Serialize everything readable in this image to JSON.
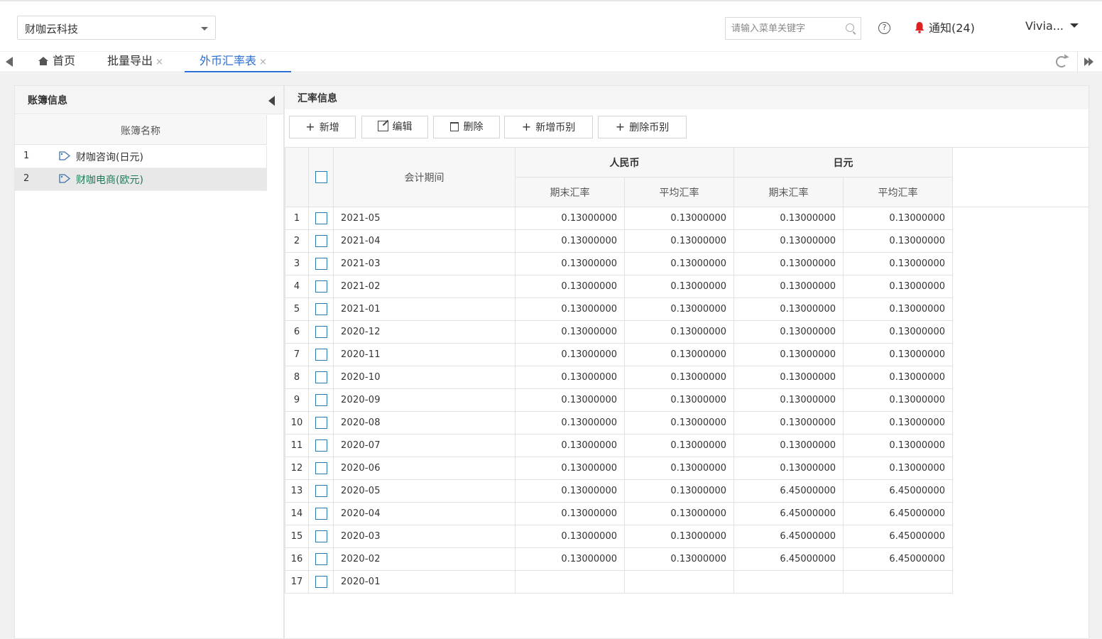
{
  "company": {
    "name": "财咖云科技"
  },
  "search": {
    "placeholder": "请输入菜单关键字"
  },
  "help": {
    "glyph": "?"
  },
  "notification": {
    "label": "通知(24)",
    "bell_color": "#e02020"
  },
  "user": {
    "name": "Vivia..."
  },
  "tabs": [
    {
      "label": "首页",
      "icon": "home-icon"
    },
    {
      "label": "批量导出",
      "close": "×"
    },
    {
      "label": "外币汇率表",
      "close": "×",
      "active": true
    }
  ],
  "colors": {
    "accent": "#2b6fd6",
    "selected_text": "#1e7b58",
    "checkbox": "#2a7ab0"
  },
  "ledger_panel": {
    "title": "账簿信息",
    "column_header": "账簿名称",
    "items": [
      {
        "index": "1",
        "name": "财咖咨询(日元)",
        "icon": "tag-icon"
      },
      {
        "index": "2",
        "name": "财咖电商(欧元)",
        "icon": "tag-icon",
        "selected": true
      }
    ]
  },
  "rate_panel": {
    "title": "汇率信息",
    "toolbar": {
      "add": "新增",
      "edit": "编辑",
      "delete": "删除",
      "add_currency": "新增币别",
      "delete_currency": "删除币别"
    },
    "columns": {
      "period": "会计期间",
      "currency1": "人民币",
      "currency2": "日元",
      "end_rate": "期末汇率",
      "avg_rate": "平均汇率"
    },
    "rows": [
      {
        "no": "1",
        "period": "2021-05",
        "cny_end": "0.13000000",
        "cny_avg": "0.13000000",
        "jpy_end": "0.13000000",
        "jpy_avg": "0.13000000"
      },
      {
        "no": "2",
        "period": "2021-04",
        "cny_end": "0.13000000",
        "cny_avg": "0.13000000",
        "jpy_end": "0.13000000",
        "jpy_avg": "0.13000000"
      },
      {
        "no": "3",
        "period": "2021-03",
        "cny_end": "0.13000000",
        "cny_avg": "0.13000000",
        "jpy_end": "0.13000000",
        "jpy_avg": "0.13000000"
      },
      {
        "no": "4",
        "period": "2021-02",
        "cny_end": "0.13000000",
        "cny_avg": "0.13000000",
        "jpy_end": "0.13000000",
        "jpy_avg": "0.13000000"
      },
      {
        "no": "5",
        "period": "2021-01",
        "cny_end": "0.13000000",
        "cny_avg": "0.13000000",
        "jpy_end": "0.13000000",
        "jpy_avg": "0.13000000"
      },
      {
        "no": "6",
        "period": "2020-12",
        "cny_end": "0.13000000",
        "cny_avg": "0.13000000",
        "jpy_end": "0.13000000",
        "jpy_avg": "0.13000000"
      },
      {
        "no": "7",
        "period": "2020-11",
        "cny_end": "0.13000000",
        "cny_avg": "0.13000000",
        "jpy_end": "0.13000000",
        "jpy_avg": "0.13000000"
      },
      {
        "no": "8",
        "period": "2020-10",
        "cny_end": "0.13000000",
        "cny_avg": "0.13000000",
        "jpy_end": "0.13000000",
        "jpy_avg": "0.13000000"
      },
      {
        "no": "9",
        "period": "2020-09",
        "cny_end": "0.13000000",
        "cny_avg": "0.13000000",
        "jpy_end": "0.13000000",
        "jpy_avg": "0.13000000"
      },
      {
        "no": "10",
        "period": "2020-08",
        "cny_end": "0.13000000",
        "cny_avg": "0.13000000",
        "jpy_end": "0.13000000",
        "jpy_avg": "0.13000000"
      },
      {
        "no": "11",
        "period": "2020-07",
        "cny_end": "0.13000000",
        "cny_avg": "0.13000000",
        "jpy_end": "0.13000000",
        "jpy_avg": "0.13000000"
      },
      {
        "no": "12",
        "period": "2020-06",
        "cny_end": "0.13000000",
        "cny_avg": "0.13000000",
        "jpy_end": "0.13000000",
        "jpy_avg": "0.13000000"
      },
      {
        "no": "13",
        "period": "2020-05",
        "cny_end": "0.13000000",
        "cny_avg": "0.13000000",
        "jpy_end": "6.45000000",
        "jpy_avg": "6.45000000"
      },
      {
        "no": "14",
        "period": "2020-04",
        "cny_end": "0.13000000",
        "cny_avg": "0.13000000",
        "jpy_end": "6.45000000",
        "jpy_avg": "6.45000000"
      },
      {
        "no": "15",
        "period": "2020-03",
        "cny_end": "0.13000000",
        "cny_avg": "0.13000000",
        "jpy_end": "6.45000000",
        "jpy_avg": "6.45000000"
      },
      {
        "no": "16",
        "period": "2020-02",
        "cny_end": "0.13000000",
        "cny_avg": "0.13000000",
        "jpy_end": "6.45000000",
        "jpy_avg": "6.45000000"
      },
      {
        "no": "17",
        "period": "2020-01",
        "cny_end": "",
        "cny_avg": "",
        "jpy_end": "",
        "jpy_avg": ""
      }
    ]
  }
}
